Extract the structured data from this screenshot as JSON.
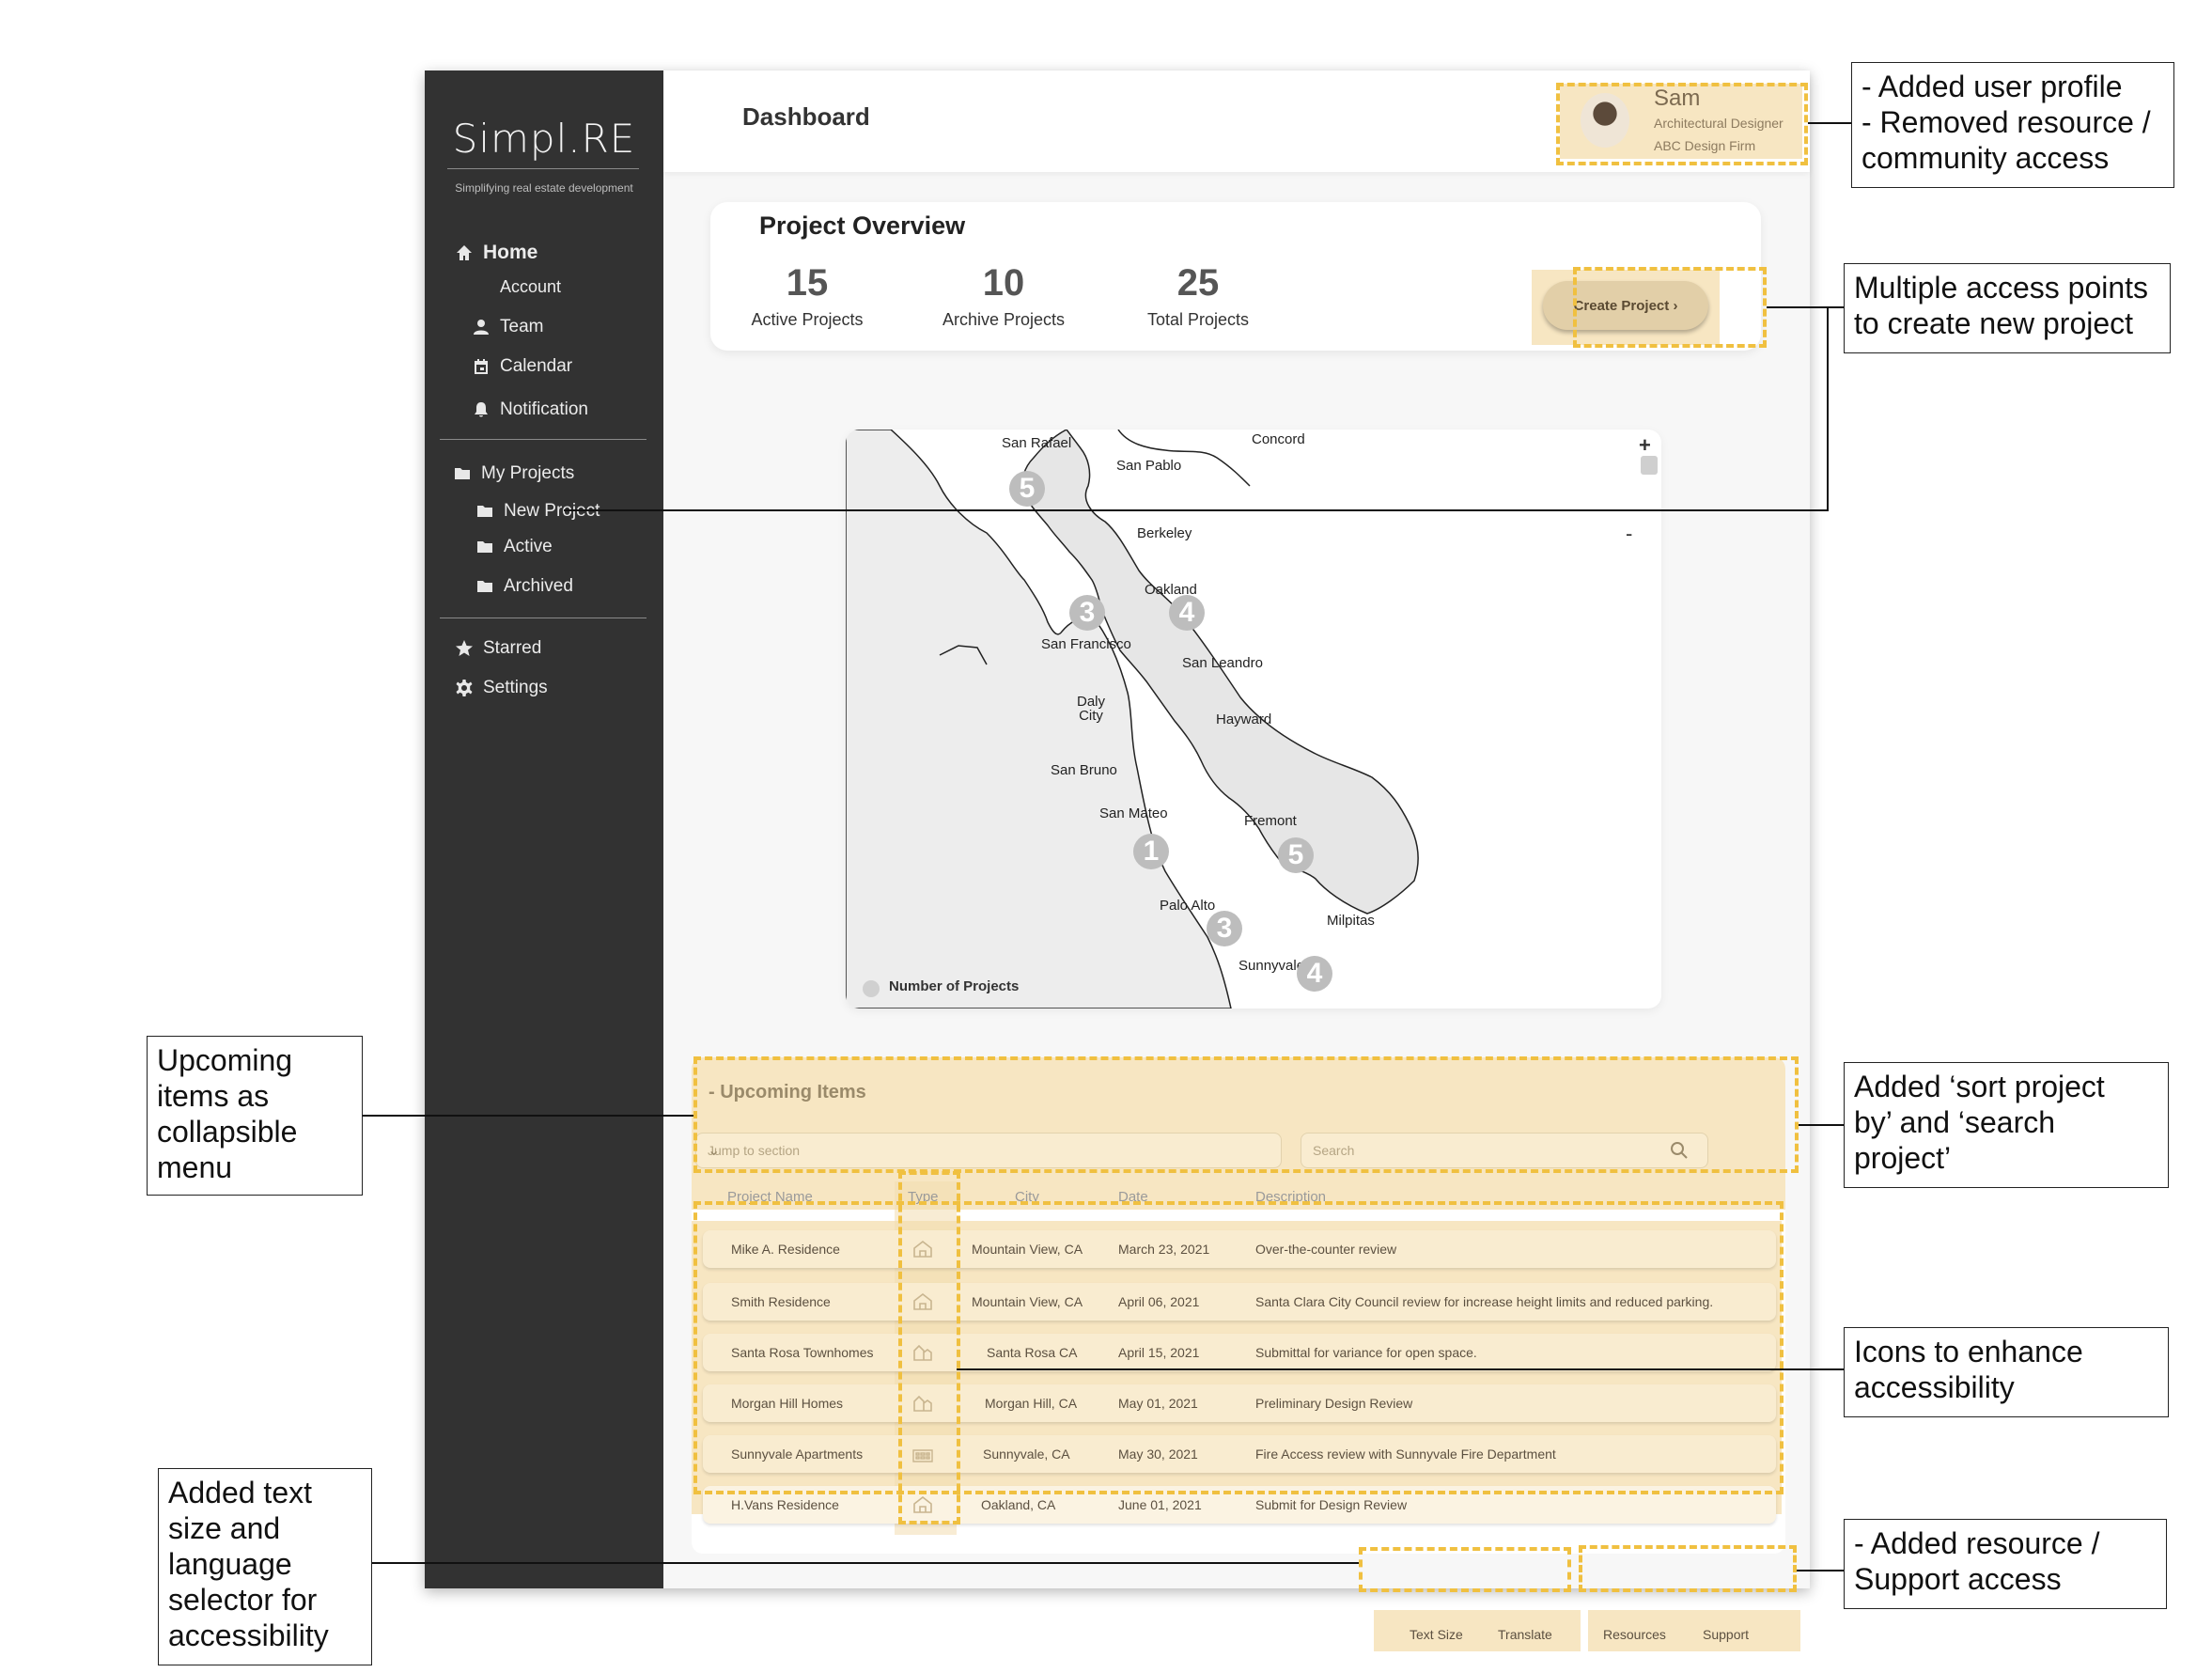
{
  "sidebar": {
    "brand": "Simpl.RE",
    "tagline": "Simplifying real estate development",
    "items": [
      {
        "label": "Home"
      },
      {
        "label": "Account"
      },
      {
        "label": "Team"
      },
      {
        "label": "Calendar"
      },
      {
        "label": "Notification"
      },
      {
        "label": "My Projects"
      },
      {
        "label": "New Project"
      },
      {
        "label": "Active"
      },
      {
        "label": "Archived"
      },
      {
        "label": "Starred"
      },
      {
        "label": "Settings"
      }
    ]
  },
  "header": {
    "title": "Dashboard",
    "profile": {
      "name": "Sam",
      "role": "Architectural Designer",
      "firm": "ABC Design Firm"
    }
  },
  "overview": {
    "title": "Project Overview",
    "stats": [
      {
        "value": "15",
        "label": "Active Projects"
      },
      {
        "value": "10",
        "label": "Archive Projects"
      },
      {
        "value": "25",
        "label": "Total Projects"
      }
    ],
    "create_label": "Create Project  ›"
  },
  "map": {
    "cities": [
      "San Rafael",
      "San Pablo",
      "Concord",
      "Berkeley",
      "Oakland",
      "San Francisco",
      "San Leandro",
      "Daly City",
      "Hayward",
      "San Bruno",
      "San Mateo",
      "Fremont",
      "Palo Alto",
      "Milpitas",
      "Sunnyvale"
    ],
    "clusters": [
      "5",
      "3",
      "4",
      "1",
      "5",
      "3",
      "4"
    ],
    "zoom_in": "+",
    "zoom_out": "-",
    "legend": "Number of Projects"
  },
  "upcoming": {
    "title": "- Upcoming Items",
    "jump_placeholder": "Jump to section",
    "search_placeholder": "Search",
    "columns": [
      "Project Name",
      "Type",
      "City",
      "Date",
      "Description"
    ],
    "rows": [
      {
        "name": "Mike A. Residence",
        "type": "house-icon",
        "city": "Mountain View, CA",
        "date": "March 23, 2021",
        "desc": "Over-the-counter review"
      },
      {
        "name": "Smith Residence",
        "type": "house-icon",
        "city": "Mountain View, CA",
        "date": "April 06, 2021",
        "desc": "Santa Clara City Council review for increase height limits and reduced parking."
      },
      {
        "name": "Santa Rosa Townhomes",
        "type": "townhome-icon",
        "city": "Santa Rosa CA",
        "date": "April 15, 2021",
        "desc": "Submittal for variance for open space."
      },
      {
        "name": "Morgan Hill Homes",
        "type": "townhome-icon",
        "city": "Morgan Hill, CA",
        "date": "May 01, 2021",
        "desc": "Preliminary Design Review"
      },
      {
        "name": "Sunnyvale Apartments",
        "type": "apartment-icon",
        "city": "Sunnyvale, CA",
        "date": "May 30, 2021",
        "desc": "Fire Access review with Sunnyvale Fire Department"
      },
      {
        "name": "H.Vans Residence",
        "type": "house-icon",
        "city": "Oakland, CA",
        "date": "June 01, 2021",
        "desc": "Submit for Design Review"
      }
    ]
  },
  "footer": {
    "text_size": "Text Size",
    "translate": "Translate",
    "resources": "Resources",
    "support": "Support"
  },
  "callouts": {
    "profile": "- Added user profile\n- Removed resource /\n   community access",
    "create": "Multiple access points\nto create new project",
    "upcoming": "Upcoming\nitems as\ncollapsible\nmenu",
    "sort": "Added ‘sort project\nby’ and ‘search\nproject’",
    "icons": "Icons to enhance\naccessibility",
    "text_size": "Added text\nsize and\nlanguage\nselector for\naccessibility",
    "resource": "- Added resource /\n  Support access"
  },
  "colors": {
    "sidebar": "#323232",
    "highlight": "#f7e6c2",
    "dash": "#f0c040"
  }
}
